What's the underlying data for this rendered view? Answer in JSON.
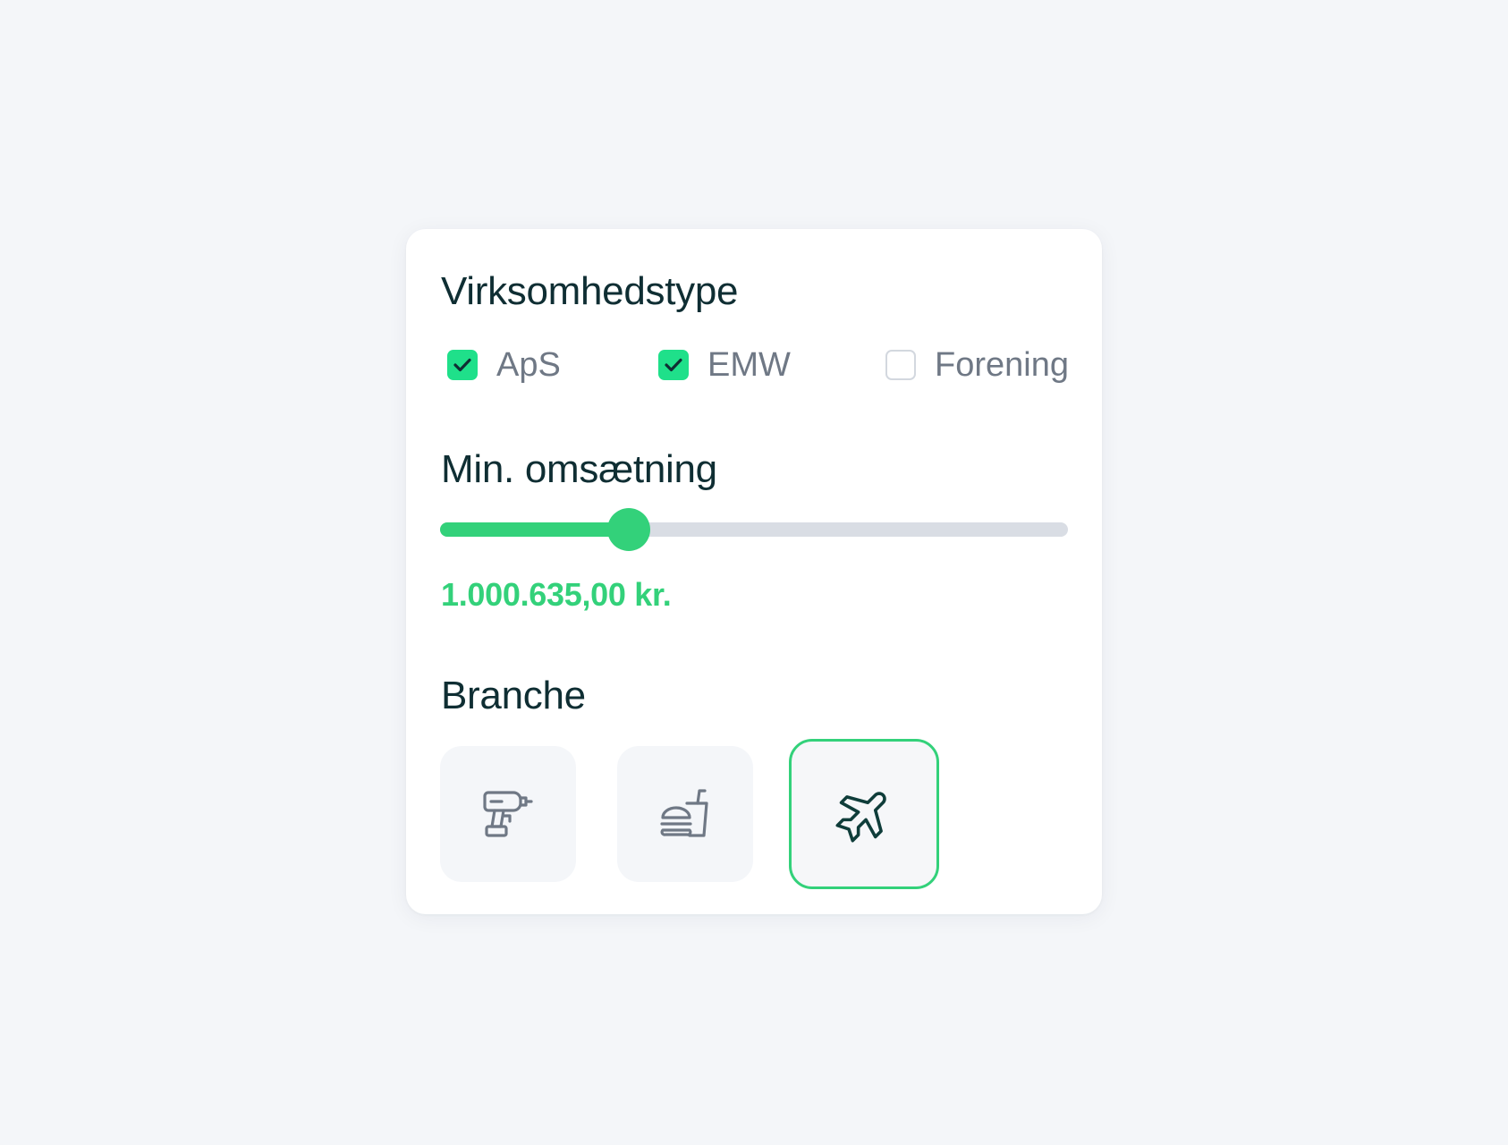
{
  "company_type": {
    "title": "Virksomhedstype",
    "options": [
      {
        "label": "ApS",
        "checked": true
      },
      {
        "label": "EMW",
        "checked": true
      },
      {
        "label": "Forening",
        "checked": false
      }
    ]
  },
  "revenue": {
    "title": "Min. omsætning",
    "slider_fraction": 0.3,
    "value": "1.000.635,00 kr."
  },
  "branch": {
    "title": "Branche",
    "tiles": [
      {
        "icon": "drill-icon",
        "selected": false
      },
      {
        "icon": "fast-food-icon",
        "selected": false
      },
      {
        "icon": "airplane-icon",
        "selected": true
      }
    ]
  },
  "colors": {
    "accent": "#33d17a",
    "checkbox": "#1fe08a",
    "heading": "#0f2e33",
    "label": "#6f7885",
    "icon_muted": "#6f7885",
    "icon_selected": "#0f3d3a"
  }
}
